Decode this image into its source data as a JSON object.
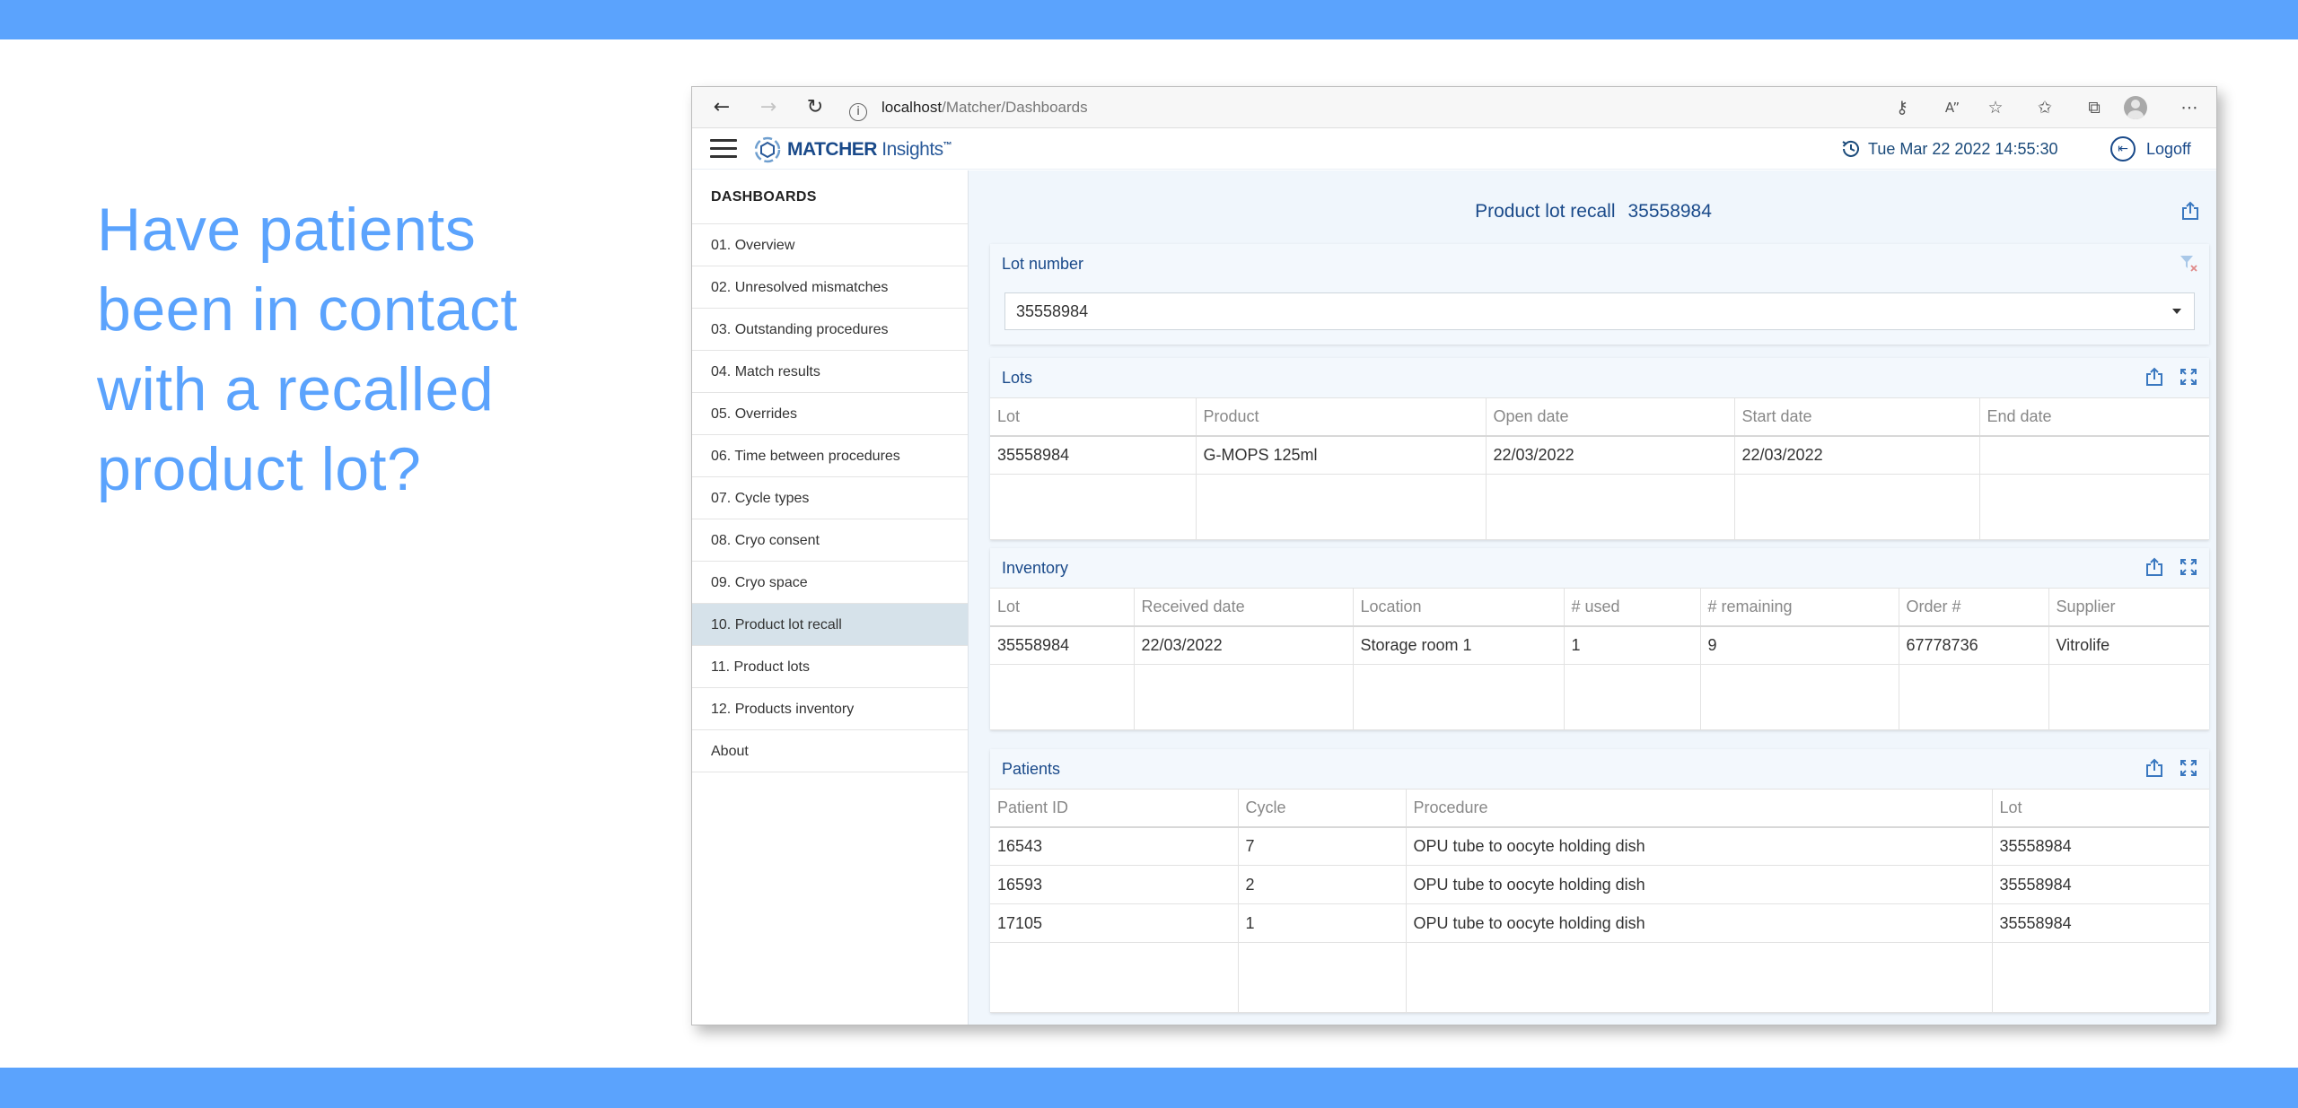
{
  "headline": "Have patients been in contact with a recalled product lot?",
  "browser": {
    "url_host": "localhost",
    "url_path": "/Matcher/Dashboards"
  },
  "header": {
    "logo_brand": "MATCHER",
    "logo_product": "Insights",
    "logo_tm": "™",
    "datetime": "Tue Mar 22 2022 14:55:30",
    "logoff_label": "Logoff"
  },
  "sidebar": {
    "title": "DASHBOARDS",
    "items": [
      {
        "label": "01. Overview"
      },
      {
        "label": "02. Unresolved mismatches"
      },
      {
        "label": "03. Outstanding procedures"
      },
      {
        "label": "04. Match results"
      },
      {
        "label": "05. Overrides"
      },
      {
        "label": "06. Time between procedures"
      },
      {
        "label": "07. Cycle types"
      },
      {
        "label": "08. Cryo consent"
      },
      {
        "label": "09. Cryo space"
      },
      {
        "label": "10. Product lot recall",
        "active": true
      },
      {
        "label": "11. Product lots"
      },
      {
        "label": "12. Products inventory"
      },
      {
        "label": "About"
      }
    ]
  },
  "page": {
    "title": "Product lot recall",
    "title_lot": "35558984"
  },
  "lot_filter": {
    "title": "Lot number",
    "selected": "35558984"
  },
  "lots": {
    "title": "Lots",
    "columns": [
      "Lot",
      "Product",
      "Open date",
      "Start date",
      "End date"
    ],
    "rows": [
      [
        "35558984",
        "G-MOPS 125ml",
        "22/03/2022",
        "22/03/2022",
        ""
      ]
    ]
  },
  "inventory": {
    "title": "Inventory",
    "columns": [
      "Lot",
      "Received date",
      "Location",
      "# used",
      "# remaining",
      "Order #",
      "Supplier"
    ],
    "rows": [
      [
        "35558984",
        "22/03/2022",
        "Storage room 1",
        "1",
        "9",
        "67778736",
        "Vitrolife"
      ]
    ]
  },
  "patients": {
    "title": "Patients",
    "columns": [
      "Patient ID",
      "Cycle",
      "Procedure",
      "Lot"
    ],
    "rows": [
      [
        "16543",
        "7",
        "OPU tube to oocyte holding dish",
        "35558984"
      ],
      [
        "16593",
        "2",
        "OPU tube to oocyte holding dish",
        "35558984"
      ],
      [
        "17105",
        "1",
        "OPU tube to oocyte holding dish",
        "35558984"
      ]
    ]
  },
  "colors": {
    "accent": "#5ba3fd",
    "brand": "#1a4a8a",
    "active_nav": "#d6e2ea"
  }
}
